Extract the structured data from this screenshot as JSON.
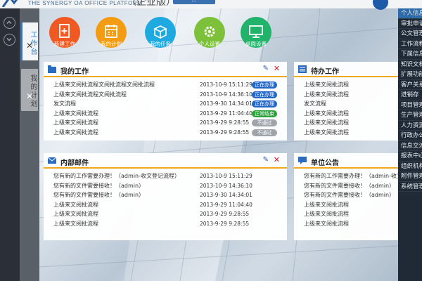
{
  "header": {
    "brand_subtitle": "THE SYNERGY OA OFFICE PLATFORM",
    "title_fragment": "（企业版）",
    "button_label": "..."
  },
  "left_nav": {
    "up_icon": "chevron-up-icon",
    "down_icon": "chevron-down-icon"
  },
  "tabs": [
    {
      "label": "工作台",
      "close": "✕"
    },
    {
      "label": "我的计划",
      "close": "✕"
    }
  ],
  "shortcuts": [
    {
      "label": "新建工作",
      "color": "#f05a22",
      "icon": "new-document-icon"
    },
    {
      "label": "我的计划",
      "color": "#f39c12",
      "icon": "calendar-icon"
    },
    {
      "label": "我的任务",
      "color": "#1fa9e1",
      "icon": "box-icon"
    },
    {
      "label": "个人设置",
      "color": "#7dc13a",
      "icon": "gear-icon"
    },
    {
      "label": "桌面设置",
      "color": "#22b36a",
      "icon": "monitor-icon"
    }
  ],
  "my_work": {
    "title": "我的工作",
    "rows": [
      {
        "title": "上级来文阅批流程文阅批流程文阅批流程",
        "time": "2013-10-9 15:11:29",
        "badge": "正在办理",
        "badge_color": "blue"
      },
      {
        "title": "上级来文阅批流程文阅批流程",
        "time": "2013-10-9 14:36:10",
        "badge": "正在办理",
        "badge_color": "blue"
      },
      {
        "title": "发文流程",
        "time": "2013-9-30 14:34:01",
        "badge": "正在办理",
        "badge_color": "blue"
      },
      {
        "title": "上级来文阅批流程",
        "time": "2013-9-29 11:04:40",
        "badge": "正常结束",
        "badge_color": "green"
      },
      {
        "title": "上级来文阅批流程",
        "time": "2013-9-29 9:28:55",
        "badge": "不通过",
        "badge_color": "gray"
      },
      {
        "title": "上级来文阅批流程",
        "time": "2013-9-29 9:28:55",
        "badge": "不通过",
        "badge_color": "gray"
      }
    ]
  },
  "todo": {
    "title": "待办工作",
    "rows": [
      "上级来文阅批流程",
      "上级来文阅批流程",
      "发文流程",
      "上级来文阅批流程",
      "上级来文阅批流程",
      "上级来文阅批流程"
    ]
  },
  "mail": {
    "title": "内部邮件",
    "rows": [
      {
        "title": "您有新的工作需要办理！（admin-收文登记流程）",
        "time": "2013-10-9 15:11:29"
      },
      {
        "title": "您有新的文件需要接收！（admin）",
        "time": "2013-10-9 14:36:10"
      },
      {
        "title": "您有新的文件需要接收！（admin）",
        "time": "2013-9-30 14:34:01"
      },
      {
        "title": "上级来文阅批流程",
        "time": "2013-9-29 11:04:40"
      },
      {
        "title": "上级来文阅批流程",
        "time": "2013-9-29 9:28:55"
      },
      {
        "title": "上级来文阅批流程",
        "time": "2013-9-29 9:28:55"
      }
    ]
  },
  "notice": {
    "title": "单位公告",
    "rows": [
      "您有新的工作需要办理！（admin-收文登记流",
      "您有新的文件需要接收！（admin）",
      "您有新的文件需要接收！（admin）",
      "上级来文阅批流程",
      "上级来文阅批流程",
      "上级来文阅批流程"
    ]
  },
  "panel_actions": {
    "edit": "✎",
    "close": "✕"
  },
  "right_menu": [
    "个人信息",
    "审批申请",
    "公文管理",
    "工作流程",
    "下属信息",
    "知识文档",
    "扩展功能",
    "客户关系",
    "进销存",
    "项目管理",
    "生产管理",
    "人力资源",
    "行政办公",
    "信息交流",
    "报表中心",
    "组织机构",
    "附件管理",
    "系统管理"
  ]
}
